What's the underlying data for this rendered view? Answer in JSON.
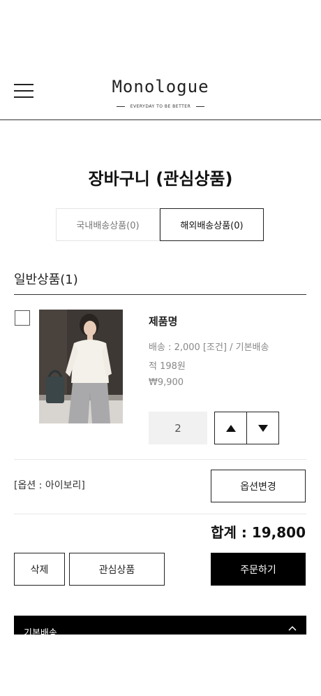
{
  "header": {
    "logo": "Monologue",
    "tagline": "EVERYDAY TO BE BETTER"
  },
  "page": {
    "title": "장바구니 (관심상품)"
  },
  "tabs": [
    {
      "label": "국내배송상품(0)",
      "active": false
    },
    {
      "label": "해외배송상품(0)",
      "active": true
    }
  ],
  "section": {
    "title": "일반상품(1)"
  },
  "product": {
    "name": "제품명",
    "shipping": "배송 : 2,000 [조건] / 기본배송",
    "points": "적 198원",
    "price": "₩9,900",
    "quantity": "2",
    "option": "[옵션 : 아이보리]"
  },
  "buttons": {
    "change_option": "옵션변경",
    "delete": "삭제",
    "wishlist": "관심상품",
    "order": "주문하기"
  },
  "total": {
    "text": "합계 : 19,800"
  },
  "shipping_bar": {
    "label": "기본배송"
  },
  "icons": [
    "hamburger-menu-icon",
    "arrow-up-icon",
    "arrow-down-icon",
    "chevron-up-icon"
  ],
  "colors": {
    "primary": "#000000",
    "border": "#222222",
    "muted": "#888888",
    "qty_bg": "#f1f1f1"
  }
}
